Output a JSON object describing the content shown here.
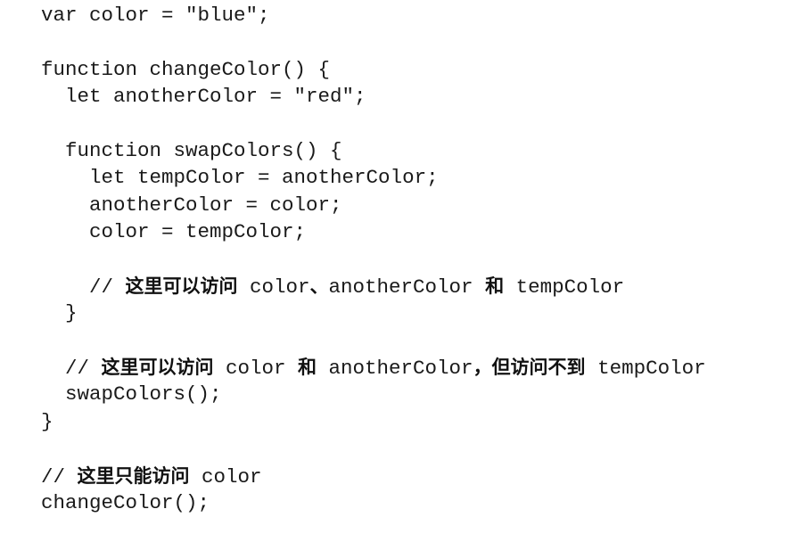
{
  "code": {
    "lines": [
      "var color = \"blue\";",
      "",
      "function changeColor() {",
      "  let anotherColor = \"red\";",
      "",
      "  function swapColors() {",
      "    let tempColor = anotherColor;",
      "    anotherColor = color;",
      "    color = tempColor;",
      "",
      "    // 这里可以访问 color、anotherColor 和 tempColor",
      "  }",
      "",
      "  // 这里可以访问 color 和 anotherColor，但访问不到 tempColor",
      "  swapColors();",
      "}",
      "",
      "// 这里只能访问 color",
      "changeColor();"
    ]
  }
}
